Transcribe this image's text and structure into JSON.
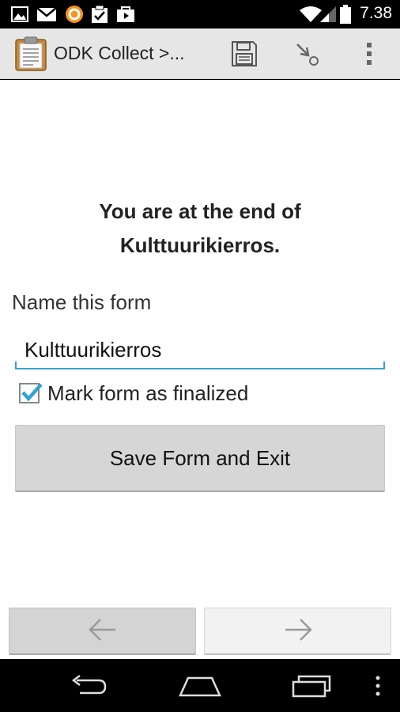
{
  "status_bar": {
    "time": "7.38",
    "left_icons": [
      "gallery-icon",
      "gmail-icon",
      "orange-app-icon",
      "clipboard-check-icon",
      "play-store-icon"
    ],
    "right_icons": [
      "wifi-icon",
      "signal-icon",
      "battery-icon"
    ]
  },
  "action_bar": {
    "title": "ODK Collect >...",
    "icons": [
      "odk-clipboard-icon",
      "save-icon",
      "go-to-icon",
      "overflow-menu-icon"
    ]
  },
  "form_end": {
    "message_line1": "You are at the end of",
    "message_line2": "Kulttuurikierros.",
    "name_label": "Name this form",
    "name_value": "Kulttuurikierros",
    "finalize_label": "Mark form as finalized",
    "finalize_checked": true,
    "save_button": "Save Form and Exit"
  },
  "navigation": {
    "prev_icon": "arrow-left-icon",
    "next_icon": "arrow-right-icon"
  },
  "system_nav": [
    "back-icon",
    "home-icon",
    "recents-icon",
    "menu-dots-icon"
  ],
  "colors": {
    "accent": "#33a2d4",
    "action_bar_bg": "#e6e6e6",
    "button_bg": "#d6d6d6"
  }
}
